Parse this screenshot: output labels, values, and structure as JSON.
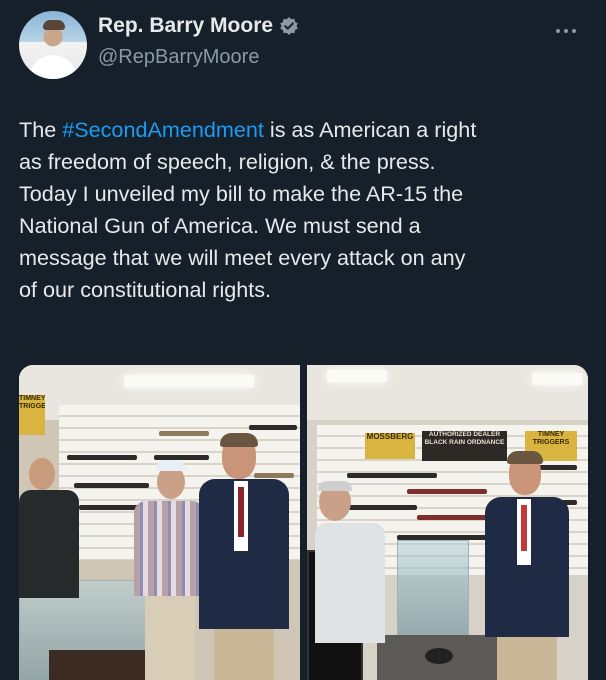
{
  "author": {
    "display_name": "Rep. Barry Moore",
    "handle": "@RepBarryMoore",
    "verified_color": "#8b98a5"
  },
  "tweet": {
    "hashtag": "#SecondAmendment",
    "text_before": "The ",
    "text_after_line1": " is as American a right",
    "line2": "as freedom of speech, religion, & the press.",
    "line3": "Today I unveiled my bill to make the AR-15 the",
    "line4": "National Gun of America. We must send a",
    "line5": "message that we will meet every attack on any",
    "line6": "of our constitutional rights."
  },
  "photos": {
    "left_sign": "TIMNEY TRIGGERS",
    "right_sign_1": "MOSSBERG",
    "right_sign_2": "AUTHORIZED DEALER BLACK RAIN ORDNANCE",
    "right_sign_3": "TIMNEY TRIGGERS"
  },
  "colors": {
    "background": "#15202b",
    "text": "#e7e9ea",
    "secondary": "#8b98a5",
    "link": "#1d9bf0"
  }
}
